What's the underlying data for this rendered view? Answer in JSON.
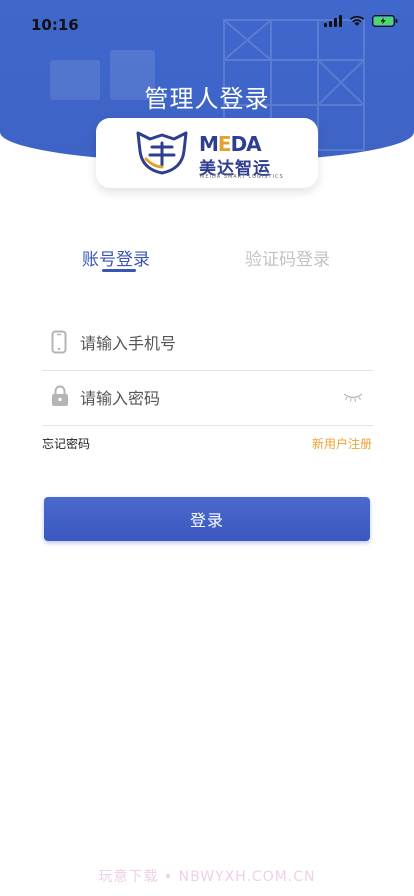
{
  "status_bar": {
    "time": "10:16"
  },
  "page": {
    "title": "管理人登录"
  },
  "logo": {
    "en_prefix": "M",
    "en_accent": "E",
    "en_suffix": "DA",
    "cn": "美达智运",
    "tagline": "MEIDA SMART LOGISTICS",
    "brand_color": "#2f3f90",
    "accent_color": "#e0a32e"
  },
  "tabs": {
    "account": "账号登录",
    "code": "验证码登录",
    "active": "account"
  },
  "form": {
    "phone_placeholder": "请输入手机号",
    "password_placeholder": "请输入密码",
    "forgot_label": "忘记密码",
    "register_label": "新用户注册",
    "login_label": "登录"
  },
  "colors": {
    "primary": "#3a56b4",
    "header": "#3f67cc",
    "link": "#f0a030"
  },
  "watermark": "玩意下载 • NBWYXH.COM.CN"
}
